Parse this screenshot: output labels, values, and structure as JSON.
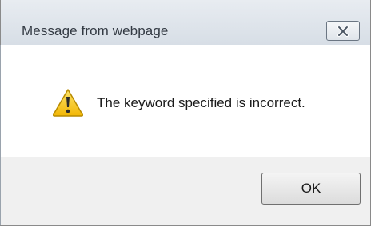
{
  "window": {
    "title": "Message from webpage"
  },
  "controls": {
    "close_icon": "close-icon"
  },
  "dialog": {
    "icon": "warning-icon",
    "message": "The keyword specified is incorrect.",
    "ok_label": "OK"
  },
  "colors": {
    "titlebar": "#dde3ea",
    "content_bg": "#ffffff",
    "footer_bg": "#f0f0f0",
    "warning_yellow": "#f7c21b"
  }
}
